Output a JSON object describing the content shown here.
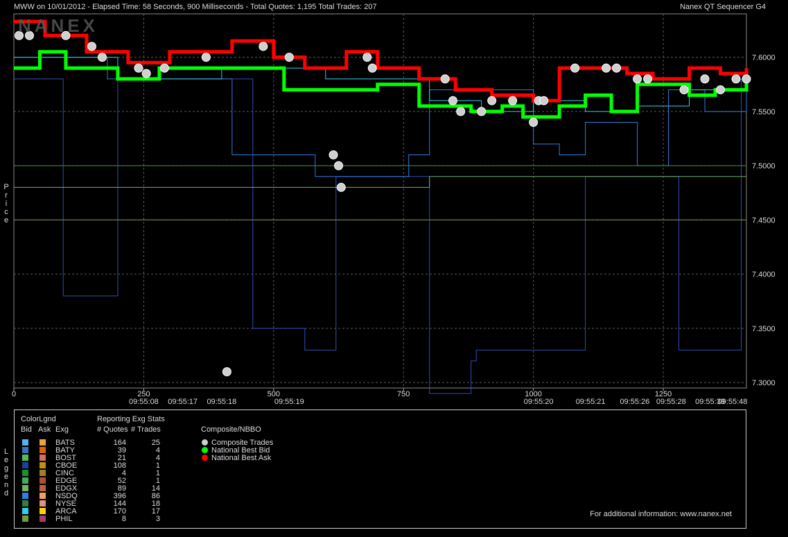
{
  "header": {
    "left": "MWW on 10/01/2012  -  Elapsed Time: 58 Seconds, 900 Milliseconds  -  Total Quotes: 1,195  Total Trades: 207",
    "right": "Nanex QT Sequencer G4"
  },
  "watermark": "NANEX",
  "side_labels": {
    "price": "Price",
    "legend": "Legend"
  },
  "colors": {
    "background": "#000000",
    "grid": "#5a5a5a",
    "nat_best_bid": "#00ff00",
    "nat_best_ask": "#ff0000",
    "composite_trade": "#cfcfcf"
  },
  "chart_data": {
    "type": "line",
    "title": "MWW on 10/01/2012",
    "ylabel": "Price",
    "xlabel": "",
    "ylim": [
      7.295,
      7.64
    ],
    "y_ticks": [
      "7.6000",
      "7.5500",
      "7.5000",
      "7.4500",
      "7.4000",
      "7.3500",
      "7.3000"
    ],
    "y_tick_values": [
      7.6,
      7.55,
      7.5,
      7.45,
      7.4,
      7.35,
      7.3
    ],
    "xlim": [
      0,
      1410
    ],
    "x_ticks_num": [
      {
        "value": 0,
        "label": "0"
      },
      {
        "value": 250,
        "label": "250"
      },
      {
        "value": 500,
        "label": "500"
      },
      {
        "value": 750,
        "label": "750"
      },
      {
        "value": 1000,
        "label": "1000"
      },
      {
        "value": 1250,
        "label": "1250"
      }
    ],
    "x_ticks_time": [
      {
        "value": 250,
        "label": "09:55:08"
      },
      {
        "value": 325,
        "label": "09:55:17"
      },
      {
        "value": 400,
        "label": "09:55:18"
      },
      {
        "value": 530,
        "label": "09:55:19"
      },
      {
        "value": 1010,
        "label": "09:55:20"
      },
      {
        "value": 1110,
        "label": "09:55:21"
      },
      {
        "value": 1195,
        "label": "09:55:26"
      },
      {
        "value": 1265,
        "label": "09:55:28"
      },
      {
        "value": 1340,
        "label": "09:55:39"
      },
      {
        "value": 1405,
        "label": "09:55:48"
      }
    ],
    "series": [
      {
        "name": "National Best Bid",
        "color": "#00ff00",
        "x": [
          0,
          50,
          100,
          200,
          280,
          380,
          470,
          520,
          600,
          700,
          780,
          830,
          880,
          940,
          980,
          1050,
          1100,
          1150,
          1200,
          1260,
          1300,
          1350,
          1410
        ],
        "values": [
          7.59,
          7.605,
          7.59,
          7.58,
          7.59,
          7.59,
          7.59,
          7.57,
          7.57,
          7.575,
          7.555,
          7.555,
          7.55,
          7.555,
          7.545,
          7.555,
          7.565,
          7.55,
          7.575,
          7.575,
          7.565,
          7.57,
          7.585
        ]
      },
      {
        "name": "National Best Ask",
        "color": "#ff0000",
        "x": [
          0,
          60,
          140,
          220,
          300,
          420,
          500,
          560,
          640,
          700,
          780,
          850,
          920,
          1000,
          1050,
          1120,
          1180,
          1230,
          1300,
          1360,
          1410
        ],
        "values": [
          7.633,
          7.62,
          7.605,
          7.595,
          7.605,
          7.615,
          7.6,
          7.59,
          7.605,
          7.59,
          7.58,
          7.57,
          7.565,
          7.56,
          7.59,
          7.59,
          7.585,
          7.58,
          7.59,
          7.585,
          7.59
        ]
      },
      {
        "name": "Composite Trades",
        "color": "#cfcfcf",
        "x": [
          10,
          30,
          100,
          150,
          170,
          240,
          255,
          290,
          370,
          410,
          480,
          530,
          615,
          625,
          630,
          680,
          690,
          830,
          845,
          860,
          900,
          920,
          960,
          1000,
          1010,
          1020,
          1080,
          1140,
          1160,
          1200,
          1220,
          1290,
          1330,
          1360,
          1390,
          1410
        ],
        "values": [
          7.62,
          7.62,
          7.62,
          7.61,
          7.6,
          7.59,
          7.585,
          7.59,
          7.6,
          7.31,
          7.61,
          7.6,
          7.51,
          7.5,
          7.48,
          7.6,
          7.59,
          7.58,
          7.56,
          7.55,
          7.55,
          7.56,
          7.56,
          7.54,
          7.56,
          7.56,
          7.59,
          7.59,
          7.59,
          7.58,
          7.58,
          7.57,
          7.58,
          7.57,
          7.58,
          7.58
        ]
      },
      {
        "name": "CBOE",
        "color": "#2f4fb8",
        "x": [
          0,
          90,
          95,
          200,
          430,
          460,
          470,
          560,
          620,
          790,
          800,
          880,
          890,
          1000,
          1090,
          1100,
          1270,
          1280,
          1390,
          1400
        ],
        "values": [
          7.58,
          7.58,
          7.38,
          7.58,
          7.58,
          7.35,
          7.35,
          7.33,
          7.49,
          7.49,
          7.29,
          7.32,
          7.33,
          7.33,
          7.33,
          7.49,
          7.49,
          7.33,
          7.33,
          7.58
        ]
      },
      {
        "name": "NSDQ",
        "color": "#2f7fe0",
        "x": [
          0,
          180,
          400,
          420,
          500,
          580,
          620,
          760,
          800,
          900,
          1000,
          1050,
          1100,
          1200,
          1260,
          1330,
          1410
        ],
        "values": [
          7.6,
          7.58,
          7.58,
          7.51,
          7.51,
          7.49,
          7.49,
          7.51,
          7.57,
          7.57,
          7.52,
          7.51,
          7.54,
          7.5,
          7.57,
          7.55,
          7.58
        ]
      },
      {
        "name": "EDGX",
        "color": "#6fb36f",
        "x": [
          0,
          400,
          560,
          800,
          1000,
          1300,
          1410
        ],
        "values": [
          7.48,
          7.48,
          7.48,
          7.49,
          7.49,
          7.49,
          7.49
        ]
      },
      {
        "name": "NYSE",
        "color": "#3f8f3f",
        "x": [
          0,
          1410
        ],
        "values": [
          7.5,
          7.5
        ]
      },
      {
        "name": "ARCA",
        "color": "#33ccee",
        "x": [
          0,
          200,
          400,
          600,
          800,
          900,
          1000,
          1100,
          1200,
          1300,
          1410
        ],
        "values": [
          7.6,
          7.58,
          7.59,
          7.58,
          7.56,
          7.55,
          7.56,
          7.55,
          7.555,
          7.57,
          7.58
        ]
      },
      {
        "name": "PHIL",
        "color": "#7a9f3a",
        "x": [
          0,
          1410
        ],
        "values": [
          7.45,
          7.45
        ]
      }
    ],
    "legend_placement": "bottom-left panel",
    "grid": true
  },
  "legend": {
    "headers": {
      "color": "ColorLgnd",
      "bid": "Bid",
      "ask": "Ask",
      "exg": "Exg",
      "stats": "Reporting Exg Stats",
      "quotes": "# Quotes",
      "trades": "# Trades",
      "composite": "Composite/NBBO"
    },
    "rows": [
      {
        "exg": "BATS",
        "quotes": "164",
        "trades": "25",
        "bid_color": "#5ab0ee",
        "ask_color": "#f0a040"
      },
      {
        "exg": "BATY",
        "quotes": "39",
        "trades": "4",
        "bid_color": "#3a70c0",
        "ask_color": "#e06010"
      },
      {
        "exg": "BOST",
        "quotes": "21",
        "trades": "4",
        "bid_color": "#4fc04f",
        "ask_color": "#d07060"
      },
      {
        "exg": "CBOE",
        "quotes": "108",
        "trades": "1",
        "bid_color": "#1f3f9f",
        "ask_color": "#c09010"
      },
      {
        "exg": "CINC",
        "quotes": "4",
        "trades": "1",
        "bid_color": "#1f8f2f",
        "ask_color": "#a08020"
      },
      {
        "exg": "EDGE",
        "quotes": "52",
        "trades": "1",
        "bid_color": "#3fae5f",
        "ask_color": "#b05030"
      },
      {
        "exg": "EDGX",
        "quotes": "89",
        "trades": "14",
        "bid_color": "#6fb36f",
        "ask_color": "#c06040"
      },
      {
        "exg": "NSDQ",
        "quotes": "396",
        "trades": "86",
        "bid_color": "#2f7fe0",
        "ask_color": "#f0a060"
      },
      {
        "exg": "NYSE",
        "quotes": "144",
        "trades": "18",
        "bid_color": "#2f7f3f",
        "ask_color": "#e09080"
      },
      {
        "exg": "ARCA",
        "quotes": "170",
        "trades": "17",
        "bid_color": "#33ccee",
        "ask_color": "#ffd000"
      },
      {
        "exg": "PHIL",
        "quotes": "8",
        "trades": "3",
        "bid_color": "#6f9f3f",
        "ask_color": "#9f3f6f"
      }
    ],
    "composite": [
      {
        "label": "Composite Trades",
        "color": "#cfcfcf"
      },
      {
        "label": "National Best Bid",
        "color": "#00ff00"
      },
      {
        "label": "National Best Ask",
        "color": "#ff0000"
      }
    ],
    "footer": "For additional information: www.nanex.net"
  }
}
